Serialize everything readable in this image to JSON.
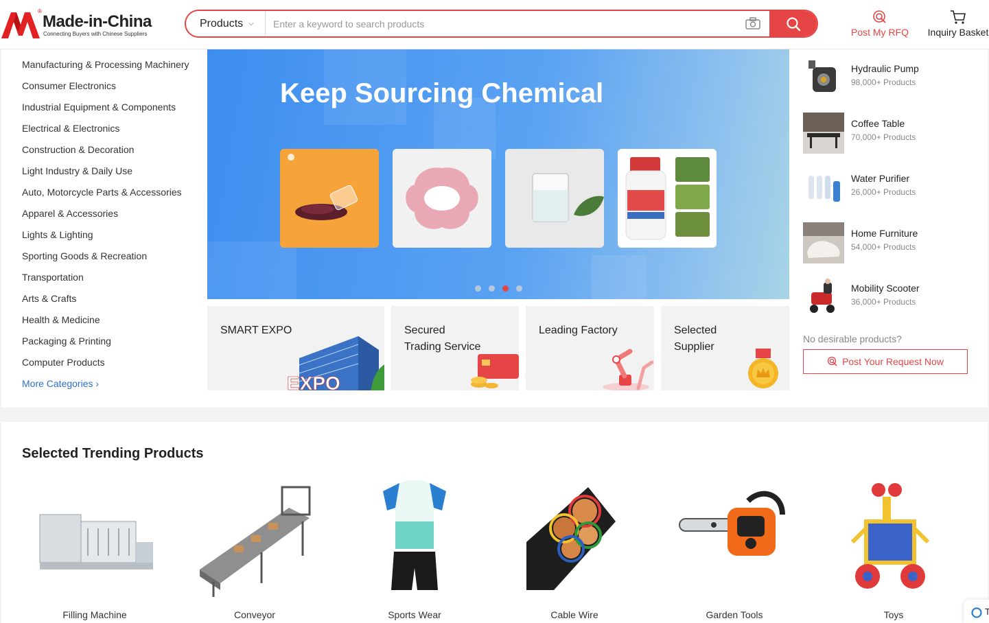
{
  "brand": {
    "name": "Made-in-China",
    "tagline": "Connecting Buyers with Chinese Suppliers",
    "reg_mark": "®",
    "color": "#e64545"
  },
  "search": {
    "category": "Products",
    "placeholder": "Enter a keyword to search products"
  },
  "header_links": {
    "rfq": "Post My RFQ",
    "basket": "Inquiry Basket"
  },
  "categories": [
    "Manufacturing & Processing Machinery",
    "Consumer Electronics",
    "Industrial Equipment & Components",
    "Electrical & Electronics",
    "Construction & Decoration",
    "Light Industry & Daily Use",
    "Auto, Motorcycle Parts & Accessories",
    "Apparel & Accessories",
    "Lights & Lighting",
    "Sporting Goods & Recreation",
    "Transportation",
    "Arts & Crafts",
    "Health & Medicine",
    "Packaging & Printing",
    "Computer Products"
  ],
  "more_categories": "More Categories",
  "banner": {
    "title": "Keep Sourcing Chemical",
    "active_slide": 3,
    "slide_count": 4,
    "expo_word": "EXPO"
  },
  "services": [
    {
      "label_1": "SMART EXPO",
      "label_2": ""
    },
    {
      "label_1": "Secured",
      "label_2": "Trading Service"
    },
    {
      "label_1": "Leading Factory",
      "label_2": ""
    },
    {
      "label_1": "Selected",
      "label_2": "Supplier"
    }
  ],
  "trending_side": [
    {
      "name": "Hydraulic Pump",
      "count": "98,000+ Products"
    },
    {
      "name": "Coffee Table",
      "count": "70,000+ Products"
    },
    {
      "name": "Water Purifier",
      "count": "26,000+ Products"
    },
    {
      "name": "Home Furniture",
      "count": "54,000+ Products"
    },
    {
      "name": "Mobility Scooter",
      "count": "36,000+ Products"
    }
  ],
  "no_products": "No desirable products?",
  "post_request": "Post Your Request Now",
  "section_title": "Selected Trending Products",
  "trending_products": [
    "Filling Machine",
    "Conveyor",
    "Sports Wear",
    "Cable Wire",
    "Garden Tools",
    "Toys"
  ],
  "chat_letter": "T"
}
